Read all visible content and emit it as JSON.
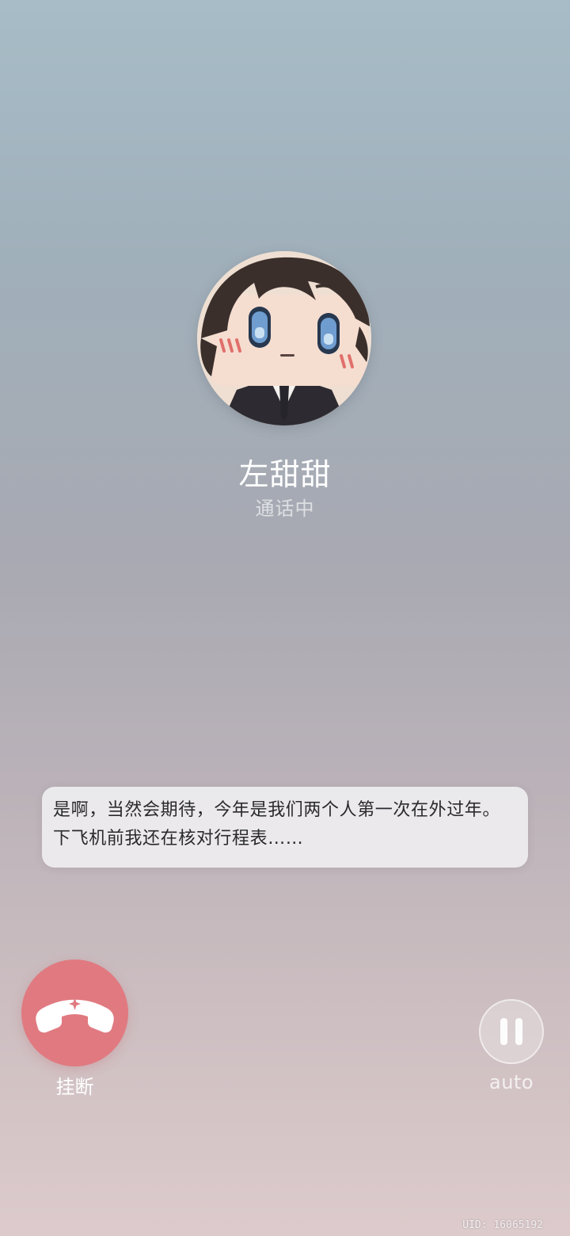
{
  "caller": {
    "name": "左甜甜",
    "status": "通话中",
    "avatar_icon": "chibi-character-avatar"
  },
  "dialogue": {
    "text": "是啊，当然会期待，今年是我们两个人第一次在外过年。下飞机前我还在核对行程表……"
  },
  "controls": {
    "hangup_label": "挂断",
    "hangup_icon": "phone-hangup-icon",
    "auto_label": "auto",
    "auto_icon": "pause-icon"
  },
  "footer": {
    "uid": "UID: 16065192"
  },
  "colors": {
    "hangup_red": "#e07a80",
    "bubble_bg": "#efedf1",
    "bubble_text": "#2a2a2e"
  }
}
